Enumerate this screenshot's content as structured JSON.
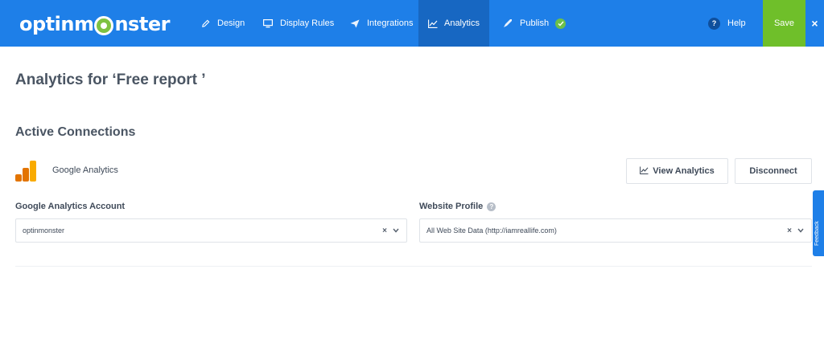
{
  "app": {
    "logo_text_left": "optinm",
    "logo_text_right": "nster"
  },
  "nav": {
    "items": [
      {
        "label": "Design",
        "icon": "pencil-icon"
      },
      {
        "label": "Display Rules",
        "icon": "monitor-icon"
      },
      {
        "label": "Integrations",
        "icon": "paper-plane-icon"
      },
      {
        "label": "Analytics",
        "icon": "line-chart-icon",
        "active": true
      },
      {
        "label": "Publish",
        "icon": "rocket-icon",
        "badge": "check-icon"
      }
    ],
    "help_label": "Help",
    "help_icon": "?",
    "save_label": "Save",
    "close_label": "×"
  },
  "page": {
    "title": "Analytics for ‘Free report ’",
    "section_title": "Active Connections"
  },
  "connection": {
    "name": "Google Analytics",
    "view_button": "View Analytics",
    "disconnect_button": "Disconnect"
  },
  "fields": {
    "account_label": "Google Analytics Account",
    "account_value": "optinmonster",
    "profile_label": "Website Profile",
    "profile_value": "All Web Site Data (http://iamreallife.com)",
    "clear_symbol": "×"
  },
  "feedback": {
    "label": "Feedback"
  },
  "colors": {
    "topbar": "#1e7fe8",
    "active_nav": "#1767c2",
    "save": "#6fbf2a",
    "ga_orange": "#f9ab00",
    "ga_dark_orange": "#e37400"
  }
}
